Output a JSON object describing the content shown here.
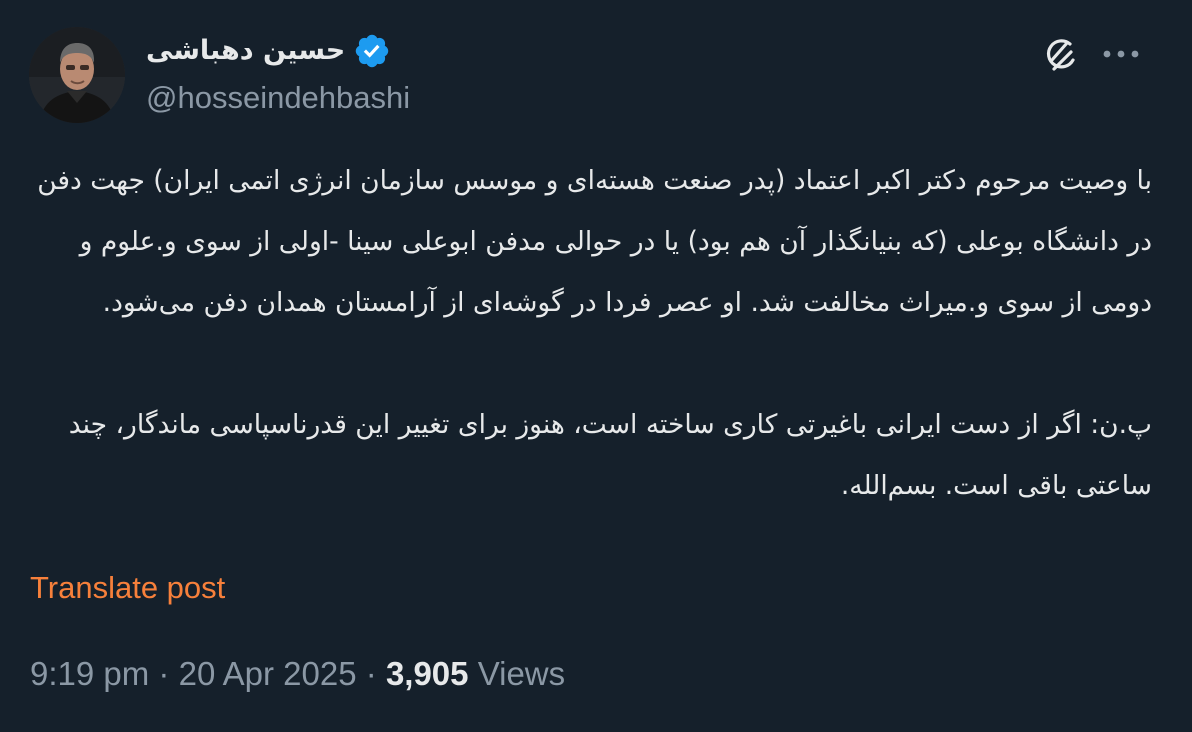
{
  "author": {
    "display_name": "حسین دهباشی",
    "handle": "@hosseindehbashi",
    "avatar_icon": "avatar-portrait",
    "verified_icon": "verified-badge-icon",
    "verified_color": "#1d9bf0"
  },
  "actions": {
    "grok_icon": "grok-icon",
    "more_icon": "more-icon"
  },
  "post": {
    "paragraphs": [
      "با وصیت مرحوم دکتر اکبر اعتماد (پدر صنعت هسته‌ای و موسس سازمان انرژی اتمی ایران) جهت دفن در دانشگاه بوعلی (که بنیانگذار آن هم بود) یا در حوالی مدفن ابوعلی سینا -اولی از سوی و.علوم و دومی از سوی و.میراث مخالفت شد. او عصر فردا در گوشه‌ای از آرامستان همدان دفن می‌شود.",
      "پ.ن: اگر از دست ایرانی باغیرتی کاری ساخته است، هنوز برای تغییر این قدرناسپاسی ماندگار، چند ساعتی باقی است. بسم‌الله."
    ],
    "translate_label": "Translate post"
  },
  "meta": {
    "time": "9:19 pm",
    "separator": "·",
    "date": "20 Apr 2025",
    "views_count": "3,905",
    "views_label": "Views"
  },
  "colors": {
    "background": "#15202b",
    "text": "#e7e9ea",
    "secondary": "#8b98a5",
    "translate": "#f7803b",
    "verified": "#1d9bf0"
  }
}
